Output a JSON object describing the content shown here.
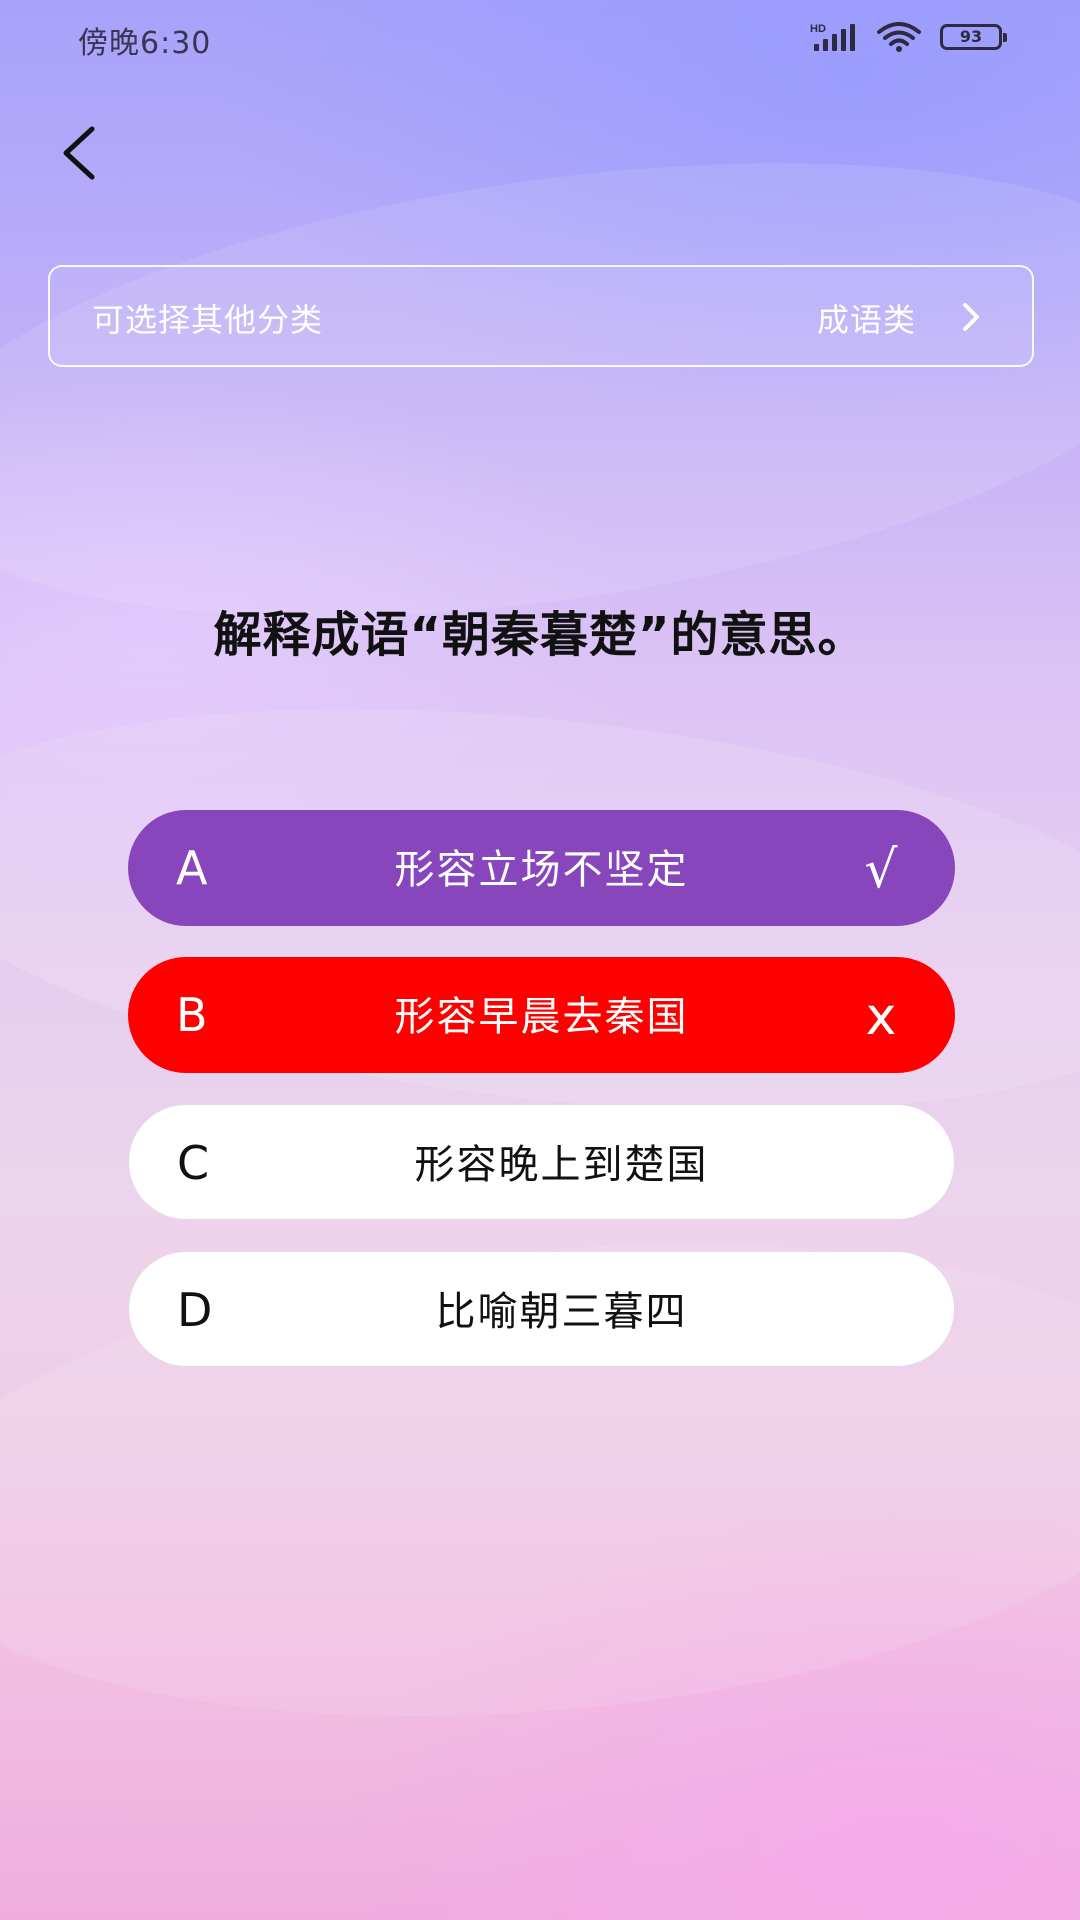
{
  "status_bar": {
    "time": "傍晚6:30",
    "network_label": "HD",
    "battery": "93"
  },
  "category": {
    "hint": "可选择其他分类",
    "current": "成语类"
  },
  "question": {
    "text": "解释成语“朝秦暮楚”的意思。"
  },
  "options": [
    {
      "letter": "A",
      "text": "形容立场不坚定",
      "state": "correct",
      "mark": "√"
    },
    {
      "letter": "B",
      "text": "形容早晨去秦国",
      "state": "wrong",
      "mark": "x"
    },
    {
      "letter": "C",
      "text": "形容晚上到楚国",
      "state": "unselected"
    },
    {
      "letter": "D",
      "text": "比喻朝三暮四",
      "state": "unselected"
    }
  ],
  "colors": {
    "correct": "#8846bd",
    "wrong": "#ff0000",
    "unselected": "#ffffff"
  },
  "icons": {
    "back": "chevron-left-icon",
    "category_arrow": "chevron-right-icon",
    "correct_mark": "check-icon",
    "wrong_mark": "cross-icon",
    "signal": "signal-icon",
    "wifi": "wifi-icon",
    "battery": "battery-icon"
  }
}
